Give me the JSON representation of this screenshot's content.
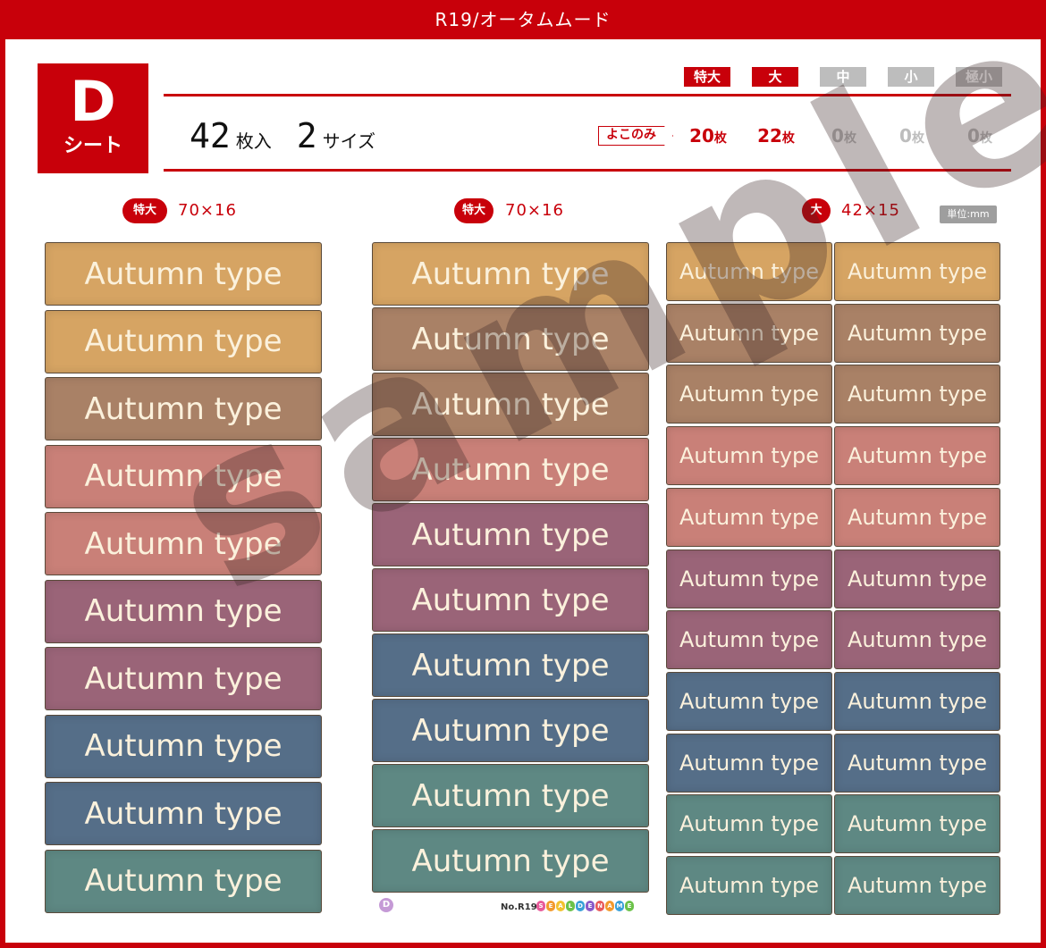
{
  "title": "R19/オータムムード",
  "badge": {
    "letter": "D",
    "sub": "シート"
  },
  "summary": {
    "count": "42",
    "count_unit": "枚入",
    "sizes": "2",
    "sizes_unit": "サイズ"
  },
  "sizes": [
    {
      "label": "特大",
      "active": true,
      "count": "20",
      "unit": "枚"
    },
    {
      "label": "大",
      "active": true,
      "count": "22",
      "unit": "枚"
    },
    {
      "label": "中",
      "active": false,
      "count": "0",
      "unit": "枚"
    },
    {
      "label": "小",
      "active": false,
      "count": "0",
      "unit": "枚"
    },
    {
      "label": "極小",
      "active": false,
      "count": "0",
      "unit": "枚"
    }
  ],
  "yoko_label": "よこのみ",
  "columns": [
    {
      "size_label": "特大",
      "dims": "70×16"
    },
    {
      "size_label": "特大",
      "dims": "70×16"
    },
    {
      "size_label": "大",
      "dims": "42×15"
    }
  ],
  "unit_label": "単位:mm",
  "label_text": "Autumn type",
  "colors": {
    "accent": "#c8000a",
    "tan": "#d6a463",
    "brown": "#a98166",
    "pink": "#c98078",
    "mauve": "#9a6478",
    "blue": "#556e88",
    "teal": "#5e8883"
  },
  "column_colors": [
    [
      "tan",
      "tan",
      "brown",
      "pink",
      "pink",
      "mauve",
      "mauve",
      "blue",
      "blue",
      "teal"
    ],
    [
      "tan",
      "brown",
      "brown",
      "pink",
      "mauve",
      "mauve",
      "blue",
      "blue",
      "teal",
      "teal"
    ],
    [
      "tan",
      "brown",
      "brown",
      "pink",
      "pink",
      "mauve",
      "mauve",
      "blue",
      "blue",
      "teal",
      "teal"
    ]
  ],
  "watermark": "sample",
  "footer": {
    "sheet": "D",
    "number": "No.R19",
    "brand": "SEALDENAME"
  }
}
